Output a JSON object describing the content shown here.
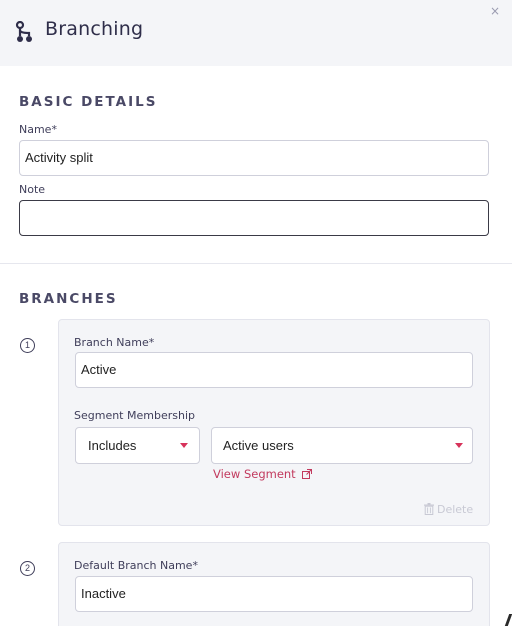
{
  "header": {
    "title": "Branching",
    "close_glyph": "×",
    "icon": "branch-icon"
  },
  "basic_details": {
    "section_title": "BASIC DETAILS",
    "name_label": "Name*",
    "name_value": "Activity split",
    "note_label": "Note",
    "note_value": ""
  },
  "branches": {
    "section_title": "BRANCHES",
    "items": [
      {
        "number": "1",
        "name_label": "Branch Name*",
        "name_value": "Active",
        "segment_label": "Segment Membership",
        "membership_value": "Includes",
        "segment_value": "Active users",
        "view_segment_label": "View Segment",
        "delete_label": "Delete"
      },
      {
        "number": "2",
        "name_label": "Default Branch Name*",
        "name_value": "Inactive"
      }
    ]
  },
  "colors": {
    "accent": "#c23a5e",
    "caret": "#d7335b",
    "header_bg": "#f4f5f8",
    "text": "#2f2e4a"
  }
}
